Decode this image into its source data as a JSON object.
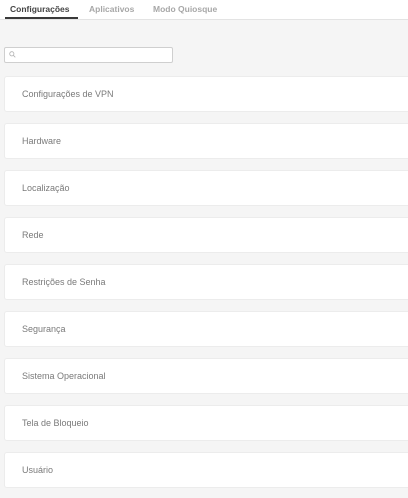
{
  "tabs": [
    {
      "label": "Configurações",
      "active": true
    },
    {
      "label": "Aplicativos",
      "active": false
    },
    {
      "label": "Modo Quiosque",
      "active": false
    }
  ],
  "search": {
    "placeholder": "",
    "value": "",
    "icon": "search-icon"
  },
  "categories": [
    {
      "label": "Configurações de VPN"
    },
    {
      "label": "Hardware"
    },
    {
      "label": "Localização"
    },
    {
      "label": "Rede"
    },
    {
      "label": "Restrições de Senha"
    },
    {
      "label": "Segurança"
    },
    {
      "label": "Sistema Operacional"
    },
    {
      "label": "Tela de Bloqueio"
    },
    {
      "label": "Usuário"
    }
  ],
  "colors": {
    "active_tab": "#444444",
    "inactive_tab": "#a7a7a7",
    "background": "#f5f5f5",
    "card": "#ffffff"
  }
}
